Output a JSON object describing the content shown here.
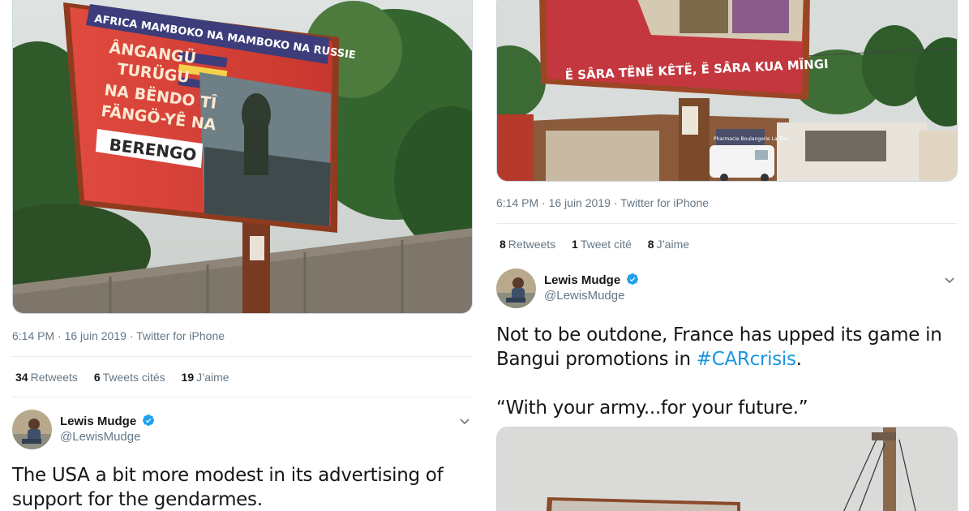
{
  "left": {
    "photo": {
      "billboard_top": "AFRICA MAMBOKO NA MAMBOKO NA RUSSIE",
      "billboard_lines": [
        "ÂNGANGÜ",
        "TURÜGU",
        "NA BËNDO TÎ",
        "FÄNGÖ-YÊ NA"
      ],
      "billboard_name": "BERENGO"
    },
    "timestamp": "6:14 PM · 16 juin 2019",
    "separator": " · ",
    "source": "Twitter for iPhone",
    "stats": [
      {
        "count": "34",
        "label": "Retweets"
      },
      {
        "count": "6",
        "label": "Tweets cités"
      },
      {
        "count": "19",
        "label": "J’aime"
      }
    ],
    "reply": {
      "name": "Lewis Mudge",
      "handle": "@LewisMudge",
      "text": "The USA a bit more modest in its advertising of support for the gendarmes."
    }
  },
  "right": {
    "photo": {
      "billboard_slogan": "Ë SÂRA TËNË KÊTË, Ë SÂRA KUA MÏNGI",
      "shop_sign": "Pharmacie Boulangerie La Trac"
    },
    "timestamp": "6:14 PM · 16 juin 2019",
    "separator": " · ",
    "source": "Twitter for iPhone",
    "stats": [
      {
        "count": "8",
        "label": "Retweets"
      },
      {
        "count": "1",
        "label": "Tweet cité"
      },
      {
        "count": "8",
        "label": "J’aime"
      }
    ],
    "reply": {
      "name": "Lewis Mudge",
      "handle": "@LewisMudge",
      "text_before": "Not to be outdone, France has upped its game in Bangui promotions in ",
      "hashtag": "#CARcrisis",
      "text_after": ".",
      "quote": "“With your army...for your future.”"
    }
  },
  "colors": {
    "link": "#1b95e0",
    "secondary_text": "#657786",
    "divider": "#e6ecf0",
    "verified": "#1da1f2"
  }
}
